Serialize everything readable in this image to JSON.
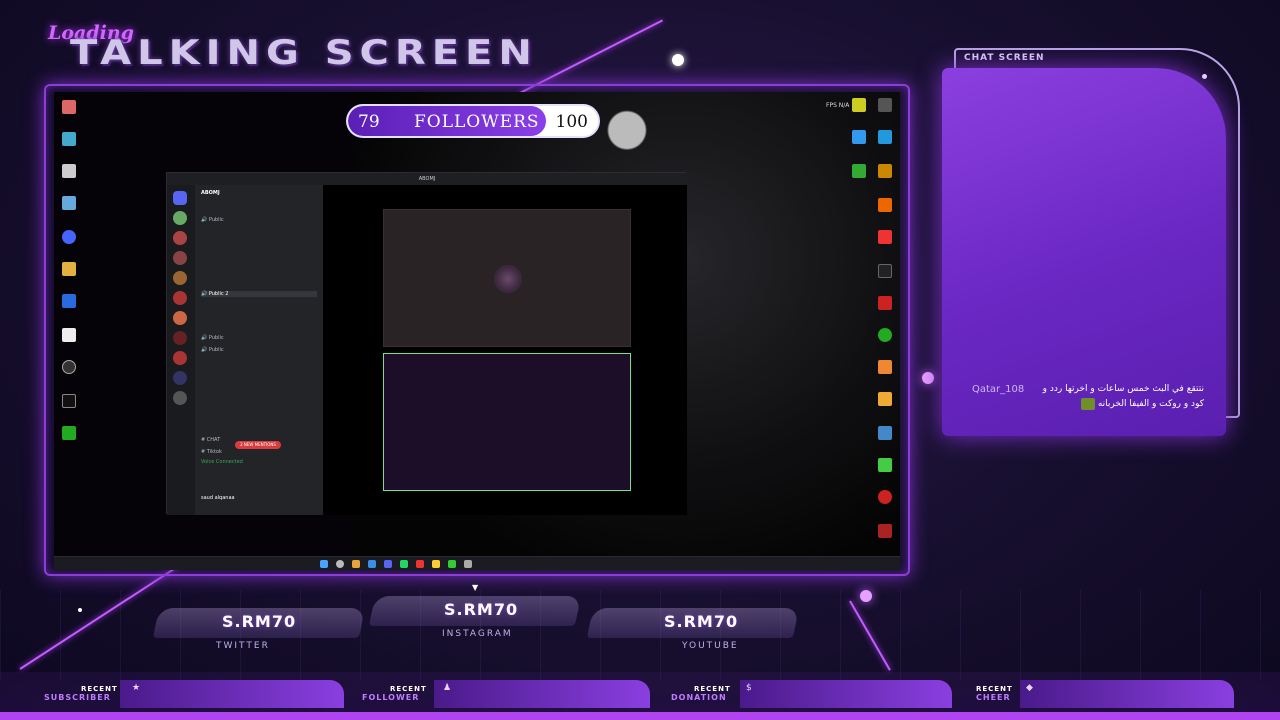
{
  "overlay": {
    "loading_text": "Loading",
    "title": "TALKING SCREEN"
  },
  "followers": {
    "current": "79",
    "label": "FOLLOWERS",
    "goal": "100",
    "progress_fraction": 0.79
  },
  "desktop": {
    "fps_label": "FPS N/A"
  },
  "discord": {
    "server_name": "ABOMJ",
    "voice_connected_label": "Voice Connected",
    "voice_channel": "Public",
    "channel_count": "2",
    "chat_channel": "CHAT",
    "tiktok_channel": "Tiktok",
    "mentions_label": "2 NEW MENTIONS",
    "user_name": "saud alqanaa"
  },
  "chat": {
    "label": "CHAT SCREEN",
    "message_user": "Qatar_108",
    "message_text": "نتتقع في البث خمس ساعات و اخرتها ردد و كود و روكت و الفيفا الخربانه"
  },
  "socials": [
    {
      "handle": "S.RM70",
      "platform": "TWITTER"
    },
    {
      "handle": "S.RM70",
      "platform": "INSTAGRAM"
    },
    {
      "handle": "S.RM70",
      "platform": "YOUTUBE"
    }
  ],
  "recent": [
    {
      "word": "RECENT",
      "type": "SUBSCRIBER",
      "icon": "star-icon"
    },
    {
      "word": "RECENT",
      "type": "FOLLOWER",
      "icon": "person-icon"
    },
    {
      "word": "RECENT",
      "type": "DONATION",
      "icon": "dollar-icon"
    },
    {
      "word": "RECENT",
      "type": "CHEER",
      "icon": "gem-icon"
    }
  ],
  "colors": {
    "accent": "#8b3fe0",
    "neon": "#c35cff",
    "background": "#170f2e"
  }
}
